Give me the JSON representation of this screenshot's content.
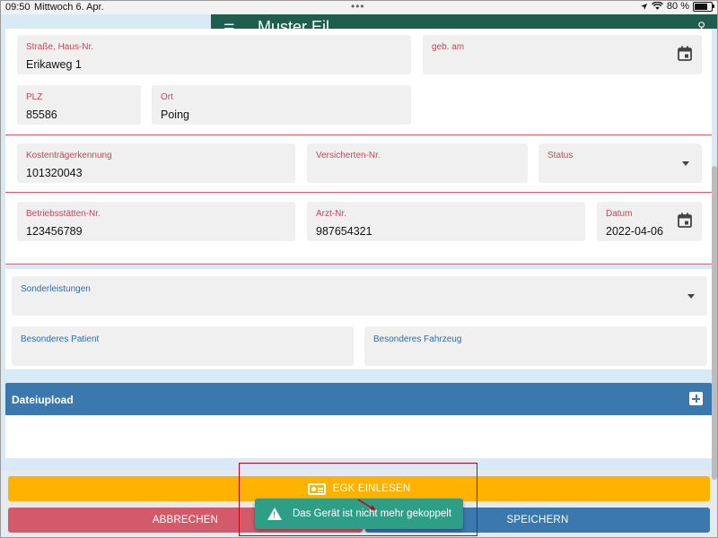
{
  "status_bar": {
    "time": "09:50",
    "date": "Mittwoch 6. Apr.",
    "battery_text": "80 %",
    "battery_level": 0.8
  },
  "app_header": {
    "title": "Muster Eil..."
  },
  "patient": {
    "street": {
      "label": "Straße, Haus-Nr.",
      "value": "Erikaweg 1"
    },
    "birth": {
      "label": "geb. am",
      "value": ""
    },
    "zip": {
      "label": "PLZ",
      "value": "85586"
    },
    "city": {
      "label": "Ort",
      "value": "Poing"
    }
  },
  "insurance": {
    "cost_id": {
      "label": "Kostenträgerkennung",
      "value": "101320043"
    },
    "insured_no": {
      "label": "Versicherten-Nr.",
      "value": ""
    },
    "status": {
      "label": "Status",
      "value": ""
    }
  },
  "practice": {
    "site_no": {
      "label": "Betriebsstätten-Nr.",
      "value": "123456789"
    },
    "doctor_no": {
      "label": "Arzt-Nr.",
      "value": "987654321"
    },
    "date": {
      "label": "Datum",
      "value": "2022-04-06"
    }
  },
  "extras": {
    "special": {
      "label": "Sonderleistungen",
      "value": ""
    },
    "special_patient": {
      "label": "Besonderes Patient",
      "value": ""
    },
    "special_vehicle": {
      "label": "Besonderes Fahrzeug",
      "value": ""
    }
  },
  "upload": {
    "title": "Dateiupload"
  },
  "buttons": {
    "egk": "EGK EINLESEN",
    "cancel": "ABBRECHEN",
    "save": "SPEICHERN"
  },
  "toast": {
    "message": "Das Gerät ist nicht mehr gekoppelt"
  },
  "icons": {
    "calendar": "calendar-icon",
    "dropdown": "chevron-down-icon",
    "add": "plus-icon",
    "card": "id-card-icon",
    "warning": "warning-icon"
  },
  "colors": {
    "accent_red": "#c0485c",
    "accent_blue": "#3b78ae",
    "egk_yellow": "#ffb300",
    "toast_green": "#2f9e87",
    "header_green": "#1f5e4e"
  }
}
